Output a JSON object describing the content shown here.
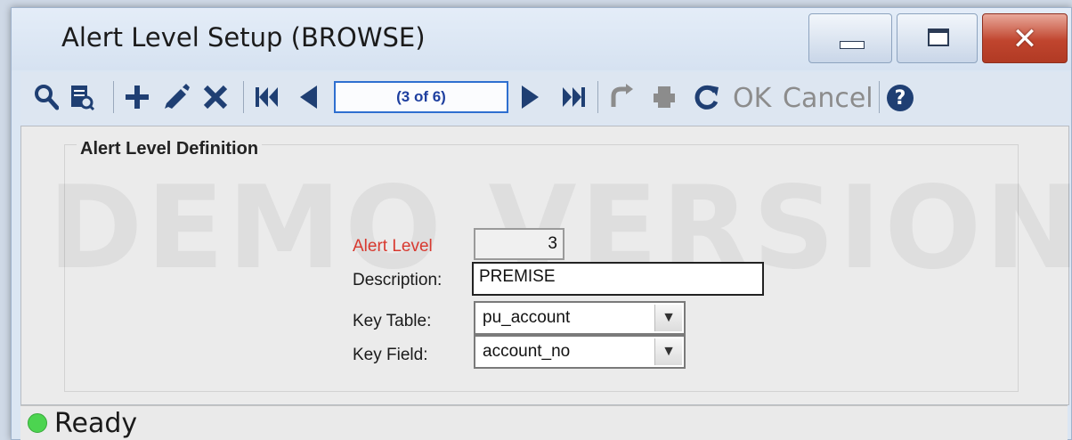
{
  "window": {
    "title": "Alert Level Setup (BROWSE)",
    "close_glyph": "✕"
  },
  "toolbar": {
    "record_position": "(3 of 6)",
    "ok_label": "OK",
    "cancel_label": "Cancel",
    "help_glyph": "?",
    "icons": [
      "search-icon",
      "preview-icon",
      "add-icon",
      "edit-icon",
      "delete-icon",
      "first-record-icon",
      "previous-record-icon",
      "next-record-icon",
      "last-record-icon",
      "undo-icon",
      "print-icon",
      "refresh-icon",
      "help-icon"
    ]
  },
  "form": {
    "group_title": "Alert Level Definition",
    "watermark": "DEMO VERSION",
    "alert_level_label": "Alert Level",
    "alert_level_value": "3",
    "description_label": "Description:",
    "description_value": "PREMISE",
    "key_table_label": "Key Table:",
    "key_table_value": "pu_account",
    "key_field_label": "Key Field:",
    "key_field_value": "account_no"
  },
  "status": {
    "text": "Ready",
    "indicator_color": "#4cd450"
  }
}
